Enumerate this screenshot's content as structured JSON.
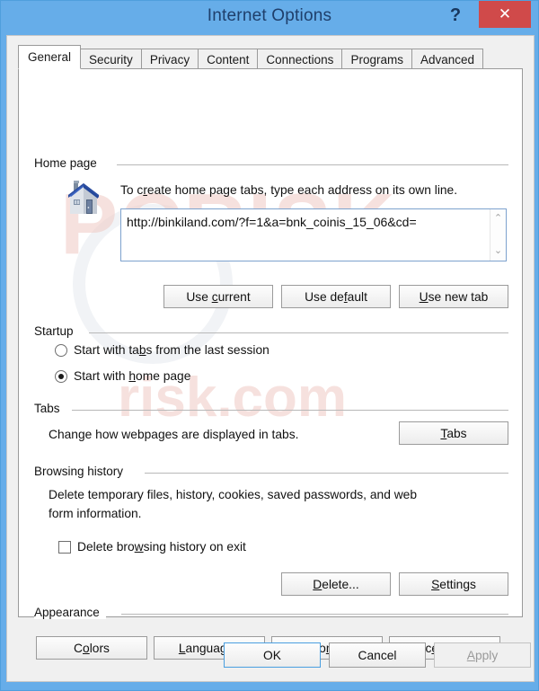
{
  "window": {
    "title": "Internet Options",
    "help_label": "?",
    "close_label": "✕",
    "titlebar_color": "#66ade9",
    "close_color": "#d04a4a"
  },
  "tabs": [
    {
      "label": "General",
      "active": true
    },
    {
      "label": "Security",
      "active": false
    },
    {
      "label": "Privacy",
      "active": false
    },
    {
      "label": "Content",
      "active": false
    },
    {
      "label": "Connections",
      "active": false
    },
    {
      "label": "Programs",
      "active": false
    },
    {
      "label": "Advanced",
      "active": false
    }
  ],
  "home_page": {
    "group_title": "Home page",
    "description": "To create home page tabs, type each address on its own line.",
    "url_value": "http://binkiland.com/?f=1&a=bnk_coinis_15_06&cd=",
    "scroll_up": "⌃",
    "scroll_down": "⌄",
    "buttons": {
      "use_current": "Use current",
      "use_default": "Use default",
      "use_new_tab": "Use new tab"
    }
  },
  "startup": {
    "group_title": "Startup",
    "options": [
      {
        "label": "Start with tabs from the last session",
        "selected": false
      },
      {
        "label": "Start with home page",
        "selected": true
      }
    ]
  },
  "tabs_section": {
    "group_title": "Tabs",
    "description": "Change how webpages are displayed in tabs.",
    "button": "Tabs"
  },
  "browsing_history": {
    "group_title": "Browsing history",
    "description_line1": "Delete temporary files, history, cookies, saved passwords, and web",
    "description_line2": "form information.",
    "checkbox_label": "Delete browsing history on exit",
    "checkbox_checked": false,
    "buttons": {
      "delete": "Delete...",
      "settings": "Settings"
    }
  },
  "appearance": {
    "group_title": "Appearance",
    "buttons": {
      "colors": "Colors",
      "languages": "Languages",
      "fonts": "Fonts",
      "accessibility": "Accessibility"
    }
  },
  "footer": {
    "ok": "OK",
    "cancel": "Cancel",
    "apply": "Apply",
    "apply_disabled": true
  },
  "watermark": {
    "line1": "PCRISK",
    "line2": "risk.com"
  }
}
